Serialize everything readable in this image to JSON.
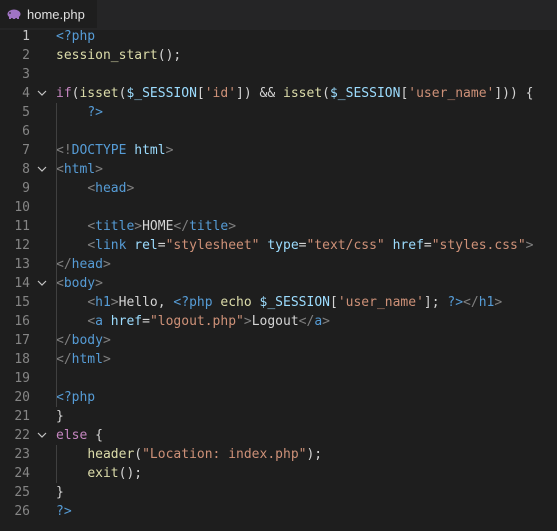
{
  "tab": {
    "filename": "home.php",
    "icon": "php-elephant-icon"
  },
  "colors": {
    "background": "#1e1e1e",
    "keyword": "#569cd6",
    "function": "#dcdcaa",
    "variable": "#9cdcfe",
    "string": "#ce9178",
    "control": "#c586c0",
    "bracket": "#808080"
  },
  "lines": [
    {
      "number": "1",
      "fold": false,
      "tokens": [
        {
          "c": "php",
          "t": "<?php"
        }
      ]
    },
    {
      "number": "2",
      "fold": false,
      "tokens": [
        {
          "c": "fn",
          "t": "session_start"
        },
        {
          "c": "op",
          "t": "();"
        }
      ]
    },
    {
      "number": "3",
      "fold": false,
      "tokens": []
    },
    {
      "number": "4",
      "fold": true,
      "tokens": [
        {
          "c": "kw",
          "t": "if"
        },
        {
          "c": "op",
          "t": "("
        },
        {
          "c": "fn",
          "t": "isset"
        },
        {
          "c": "op",
          "t": "("
        },
        {
          "c": "var",
          "t": "$_SESSION"
        },
        {
          "c": "op",
          "t": "["
        },
        {
          "c": "str",
          "t": "'id'"
        },
        {
          "c": "op",
          "t": "]) && "
        },
        {
          "c": "fn",
          "t": "isset"
        },
        {
          "c": "op",
          "t": "("
        },
        {
          "c": "var",
          "t": "$_SESSION"
        },
        {
          "c": "op",
          "t": "["
        },
        {
          "c": "str",
          "t": "'user_name'"
        },
        {
          "c": "op",
          "t": "])) {"
        }
      ]
    },
    {
      "number": "5",
      "fold": false,
      "tokens": [
        {
          "c": "txt",
          "t": "    "
        },
        {
          "c": "php",
          "t": "?>"
        }
      ]
    },
    {
      "number": "6",
      "fold": false,
      "tokens": []
    },
    {
      "number": "7",
      "fold": false,
      "tokens": [
        {
          "c": "br",
          "t": "<!"
        },
        {
          "c": "tag",
          "t": "DOCTYPE"
        },
        {
          "c": "txt",
          "t": " "
        },
        {
          "c": "attr",
          "t": "html"
        },
        {
          "c": "br",
          "t": ">"
        }
      ]
    },
    {
      "number": "8",
      "fold": true,
      "tokens": [
        {
          "c": "br",
          "t": "<"
        },
        {
          "c": "tag",
          "t": "html"
        },
        {
          "c": "br",
          "t": ">"
        }
      ]
    },
    {
      "number": "9",
      "fold": false,
      "tokens": [
        {
          "c": "txt",
          "t": "    "
        },
        {
          "c": "br",
          "t": "<"
        },
        {
          "c": "tag",
          "t": "head"
        },
        {
          "c": "br",
          "t": ">"
        }
      ]
    },
    {
      "number": "10",
      "fold": false,
      "tokens": []
    },
    {
      "number": "11",
      "fold": false,
      "tokens": [
        {
          "c": "txt",
          "t": "    "
        },
        {
          "c": "br",
          "t": "<"
        },
        {
          "c": "tag",
          "t": "title"
        },
        {
          "c": "br",
          "t": ">"
        },
        {
          "c": "txt",
          "t": "HOME"
        },
        {
          "c": "br",
          "t": "</"
        },
        {
          "c": "tag",
          "t": "title"
        },
        {
          "c": "br",
          "t": ">"
        }
      ]
    },
    {
      "number": "12",
      "fold": false,
      "tokens": [
        {
          "c": "txt",
          "t": "    "
        },
        {
          "c": "br",
          "t": "<"
        },
        {
          "c": "tag",
          "t": "link"
        },
        {
          "c": "txt",
          "t": " "
        },
        {
          "c": "attr",
          "t": "rel"
        },
        {
          "c": "op",
          "t": "="
        },
        {
          "c": "str",
          "t": "\"stylesheet\""
        },
        {
          "c": "txt",
          "t": " "
        },
        {
          "c": "attr",
          "t": "type"
        },
        {
          "c": "op",
          "t": "="
        },
        {
          "c": "str",
          "t": "\"text/css\""
        },
        {
          "c": "txt",
          "t": " "
        },
        {
          "c": "attr",
          "t": "href"
        },
        {
          "c": "op",
          "t": "="
        },
        {
          "c": "str",
          "t": "\"styles.css\""
        },
        {
          "c": "br",
          "t": ">"
        }
      ]
    },
    {
      "number": "13",
      "fold": false,
      "tokens": [
        {
          "c": "br",
          "t": "</"
        },
        {
          "c": "tag",
          "t": "head"
        },
        {
          "c": "br",
          "t": ">"
        }
      ]
    },
    {
      "number": "14",
      "fold": true,
      "tokens": [
        {
          "c": "br",
          "t": "<"
        },
        {
          "c": "tag",
          "t": "body"
        },
        {
          "c": "br",
          "t": ">"
        }
      ]
    },
    {
      "number": "15",
      "fold": false,
      "tokens": [
        {
          "c": "txt",
          "t": "    "
        },
        {
          "c": "br",
          "t": "<"
        },
        {
          "c": "tag",
          "t": "h1"
        },
        {
          "c": "br",
          "t": ">"
        },
        {
          "c": "txt",
          "t": "Hello, "
        },
        {
          "c": "php",
          "t": "<?php"
        },
        {
          "c": "txt",
          "t": " "
        },
        {
          "c": "fn",
          "t": "echo"
        },
        {
          "c": "txt",
          "t": " "
        },
        {
          "c": "var",
          "t": "$_SESSION"
        },
        {
          "c": "op",
          "t": "["
        },
        {
          "c": "str",
          "t": "'user_name'"
        },
        {
          "c": "op",
          "t": "]; "
        },
        {
          "c": "php",
          "t": "?>"
        },
        {
          "c": "br",
          "t": "</"
        },
        {
          "c": "tag",
          "t": "h1"
        },
        {
          "c": "br",
          "t": ">"
        }
      ]
    },
    {
      "number": "16",
      "fold": false,
      "tokens": [
        {
          "c": "txt",
          "t": "    "
        },
        {
          "c": "br",
          "t": "<"
        },
        {
          "c": "tag",
          "t": "a"
        },
        {
          "c": "txt",
          "t": " "
        },
        {
          "c": "attr",
          "t": "href"
        },
        {
          "c": "op",
          "t": "="
        },
        {
          "c": "str",
          "t": "\"logout.php\""
        },
        {
          "c": "br",
          "t": ">"
        },
        {
          "c": "txt",
          "t": "Logout"
        },
        {
          "c": "br",
          "t": "</"
        },
        {
          "c": "tag",
          "t": "a"
        },
        {
          "c": "br",
          "t": ">"
        }
      ]
    },
    {
      "number": "17",
      "fold": false,
      "tokens": [
        {
          "c": "br",
          "t": "</"
        },
        {
          "c": "tag",
          "t": "body"
        },
        {
          "c": "br",
          "t": ">"
        }
      ]
    },
    {
      "number": "18",
      "fold": false,
      "tokens": [
        {
          "c": "br",
          "t": "</"
        },
        {
          "c": "tag",
          "t": "html"
        },
        {
          "c": "br",
          "t": ">"
        }
      ]
    },
    {
      "number": "19",
      "fold": false,
      "tokens": []
    },
    {
      "number": "20",
      "fold": false,
      "tokens": [
        {
          "c": "php",
          "t": "<?php"
        }
      ]
    },
    {
      "number": "21",
      "fold": false,
      "tokens": [
        {
          "c": "op",
          "t": "}"
        }
      ]
    },
    {
      "number": "22",
      "fold": true,
      "tokens": [
        {
          "c": "kw",
          "t": "else"
        },
        {
          "c": "op",
          "t": " {"
        }
      ]
    },
    {
      "number": "23",
      "fold": false,
      "tokens": [
        {
          "c": "txt",
          "t": "    "
        },
        {
          "c": "fn",
          "t": "header"
        },
        {
          "c": "op",
          "t": "("
        },
        {
          "c": "str",
          "t": "\"Location: index.php\""
        },
        {
          "c": "op",
          "t": ");"
        }
      ]
    },
    {
      "number": "24",
      "fold": false,
      "tokens": [
        {
          "c": "txt",
          "t": "    "
        },
        {
          "c": "fn",
          "t": "exit"
        },
        {
          "c": "op",
          "t": "();"
        }
      ]
    },
    {
      "number": "25",
      "fold": false,
      "tokens": [
        {
          "c": "op",
          "t": "}"
        }
      ]
    },
    {
      "number": "26",
      "fold": false,
      "tokens": [
        {
          "c": "php",
          "t": "?>"
        }
      ]
    }
  ]
}
